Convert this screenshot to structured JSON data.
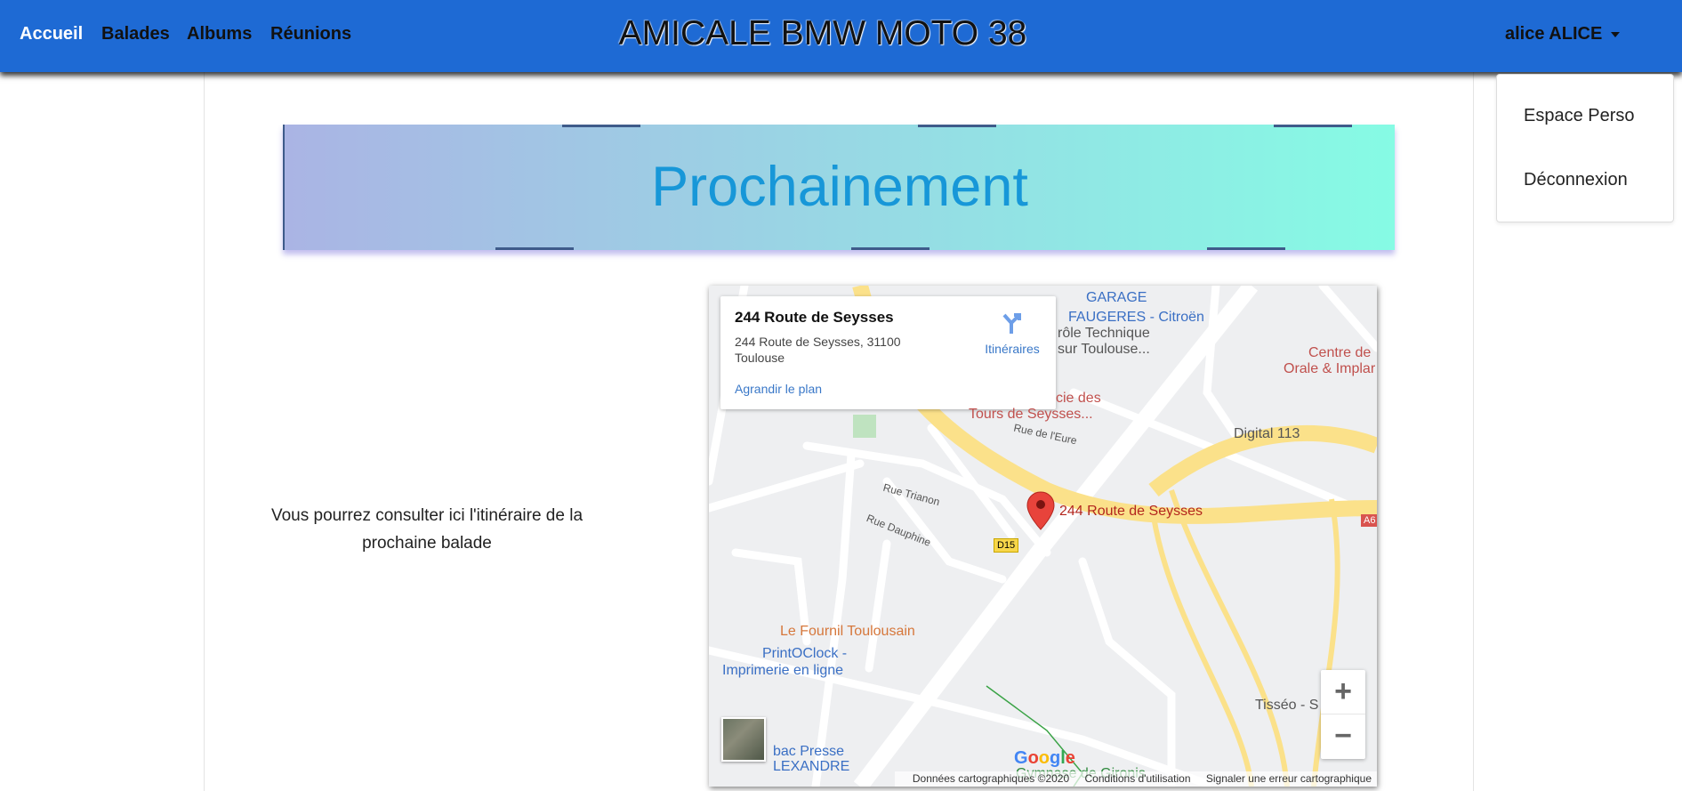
{
  "nav": {
    "items": [
      "Accueil",
      "Balades",
      "Albums",
      "Réunions"
    ],
    "brand": "AMICALE BMW MOTO 38",
    "user": "alice ALICE"
  },
  "user_menu": {
    "items": [
      "Espace Perso",
      "Déconnexion"
    ]
  },
  "banner": {
    "title": "Prochainement"
  },
  "intro": {
    "text": "Vous pourrez consulter ici l'itinéraire de la prochaine balade"
  },
  "map": {
    "card": {
      "title": "244 Route de Seysses",
      "address": "244 Route de Seysses, 31100 Toulouse",
      "directions": "Itinéraires",
      "enlarge": "Agrandir le plan"
    },
    "marker_label": "244 Route de Seysses",
    "labels": [
      {
        "text": "GARAGE",
        "color": "#3a6fc4"
      },
      {
        "text": "FAUGERES - Citroën",
        "color": "#3a6fc4"
      },
      {
        "text": "rôle Technique",
        "color": "#555"
      },
      {
        "text": "sur Toulouse...",
        "color": "#555"
      },
      {
        "text": "Centre de",
        "color": "#c0504d"
      },
      {
        "text": "Orale & Implar",
        "color": "#c0504d"
      },
      {
        "text": "cie des",
        "color": "#c0504d"
      },
      {
        "text": "Tours de Seysses...",
        "color": "#c0504d"
      },
      {
        "text": "Digital 113",
        "color": "#555"
      },
      {
        "text": "Rue de l'Eure",
        "color": "#555"
      },
      {
        "text": "Rue Trianon",
        "color": "#555"
      },
      {
        "text": "Rue Dauphine",
        "color": "#555"
      },
      {
        "text": "Le Fournil Toulousain",
        "color": "#d6773b"
      },
      {
        "text": "PrintOClock -",
        "color": "#3a6fc4"
      },
      {
        "text": "Imprimerie en ligne",
        "color": "#3a6fc4"
      },
      {
        "text": "bac Presse",
        "color": "#3a6fc4"
      },
      {
        "text": "LEXANDRE",
        "color": "#3a6fc4"
      },
      {
        "text": "Tisséo - S",
        "color": "#555"
      },
      {
        "text": "Gymnase de Gironis",
        "color": "#2f8a3e"
      },
      {
        "text": "D15",
        "color": "#333"
      },
      {
        "text": "A6",
        "color": "#fff"
      }
    ],
    "zoom_in": "+",
    "zoom_out": "−",
    "google": "Google",
    "footer": [
      "Données cartographiques ©2020",
      "Conditions d'utilisation",
      "Signaler une erreur cartographique"
    ]
  }
}
